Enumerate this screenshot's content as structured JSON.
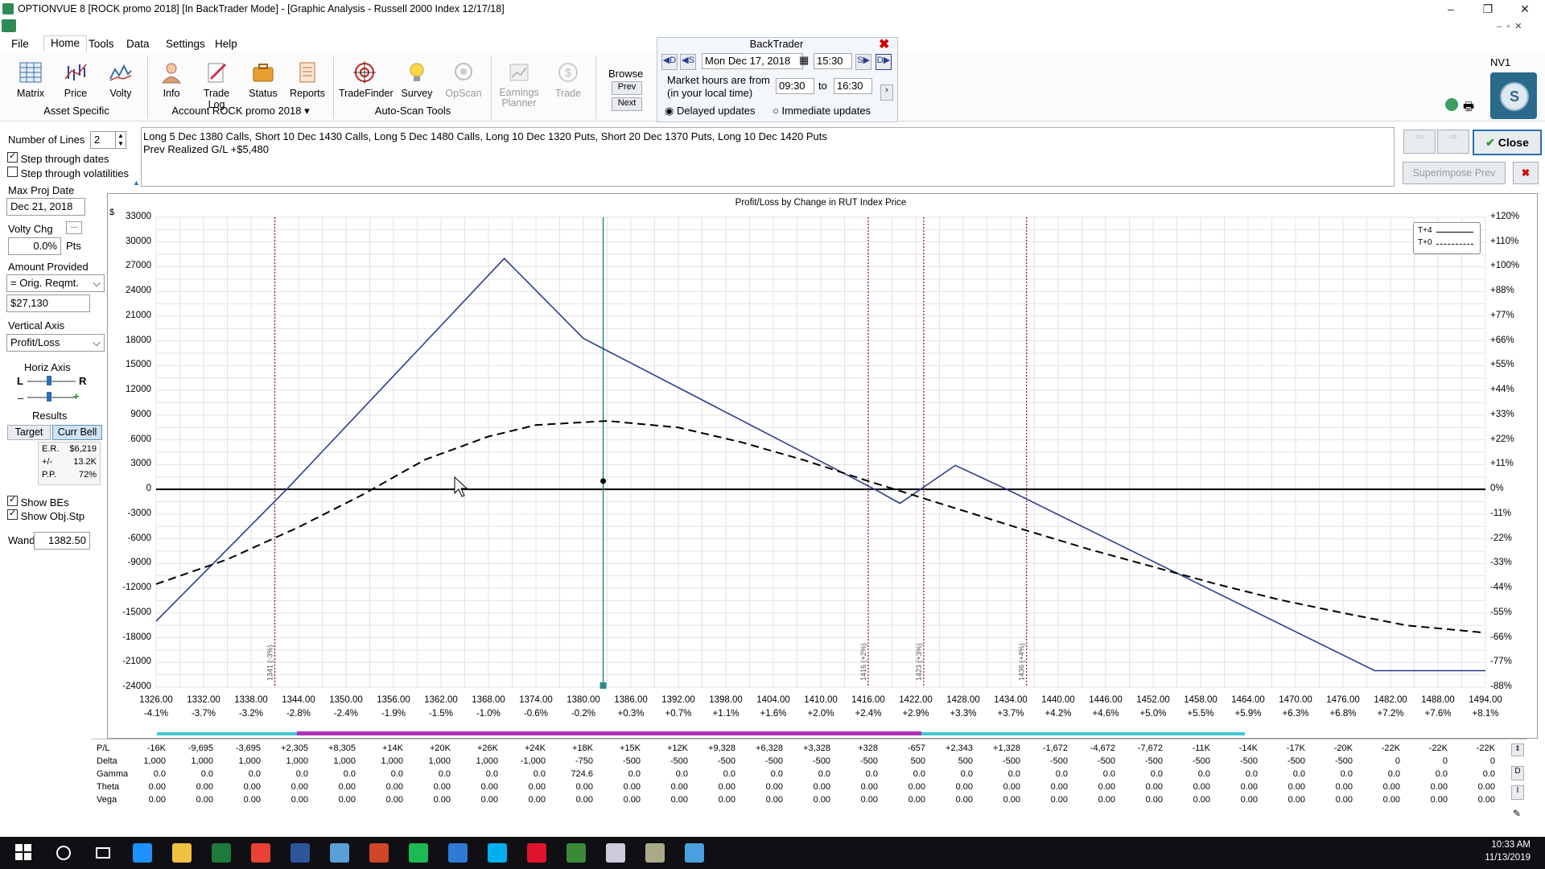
{
  "window": {
    "title": "OPTIONVUE 8   [ROCK promo 2018]   [In BackTrader Mode] - [Graphic Analysis - Russell 2000 Index  12/17/18]"
  },
  "menu": [
    "File",
    "Home",
    "Tools",
    "Data",
    "Settings",
    "Help"
  ],
  "ribbon": {
    "buttons": [
      {
        "label": "Matrix",
        "icon": "matrix-icon"
      },
      {
        "label": "Price",
        "icon": "price-chart-icon"
      },
      {
        "label": "Volty",
        "icon": "volatility-icon"
      },
      {
        "label": "Info",
        "icon": "person-info-icon"
      },
      {
        "label": "Trade Log",
        "icon": "trade-log-icon"
      },
      {
        "label": "Status",
        "icon": "briefcase-icon"
      },
      {
        "label": "Reports",
        "icon": "reports-icon"
      },
      {
        "label": "TradeFinder",
        "icon": "target-icon"
      },
      {
        "label": "Survey",
        "icon": "lightbulb-icon"
      },
      {
        "label": "OpScan",
        "icon": "opscan-icon"
      },
      {
        "label": "Earnings Planner",
        "icon": "earnings-icon"
      },
      {
        "label": "Trade",
        "icon": "dollar-icon"
      }
    ],
    "groups": {
      "asset": "Asset Specific",
      "account": "Account ROCK promo 2018",
      "autoscan": "Auto-Scan Tools"
    },
    "browse": {
      "label": "Browse",
      "prev": "Prev",
      "next": "Next"
    }
  },
  "backtrader": {
    "title": "BackTrader",
    "date": "Mon Dec 17, 2018",
    "time": "15:30",
    "market_label_1": "Market hours are from",
    "market_label_2": "(in your local time)",
    "from": "09:30",
    "to_label": "to",
    "to": "16:30",
    "delayed": "Delayed updates",
    "immediate": "Immediate updates",
    "nav": {
      "d_prev": "D",
      "s_prev": "S",
      "s_next": "S",
      "d_next": "D"
    }
  },
  "corner": {
    "label": "NV1",
    "logo": "S"
  },
  "left_panel": {
    "num_lines_label": "Number of Lines",
    "num_lines": "2",
    "step_dates": "Step through dates",
    "step_vols": "Step through volatilities",
    "max_proj_label": "Max Proj Date",
    "max_proj": "Dec 21, 2018",
    "volty_label": "Volty Chg",
    "volty_value": "0.0%",
    "volty_unit": "Pts",
    "amount_label": "Amount Provided",
    "amount_select": "= Orig. Reqmt.",
    "amount_value": "$27,130",
    "vaxis_label": "Vertical Axis",
    "vaxis_select": "Profit/Loss",
    "haxis_label": "Horiz Axis",
    "haxis_L": "L",
    "haxis_R": "R",
    "minus": "–",
    "plus": "+",
    "results_label": "Results",
    "target_btn": "Target",
    "currbell_btn": "Curr Bell",
    "stats": [
      {
        "k": "E.R.",
        "v": "$6,219"
      },
      {
        "k": "+/-",
        "v": "13.2K"
      },
      {
        "k": "P.P.",
        "v": "72%"
      }
    ],
    "show_bes": "Show BEs",
    "show_objstp": "Show Obj.Stp",
    "wand_label": "Wand",
    "wand_value": "1382.50"
  },
  "positions": {
    "line1": "Long 5 Dec 1380 Calls, Short 10 Dec 1430 Calls, Long 5 Dec 1480 Calls, Long 10 Dec 1320 Puts, Short 20 Dec 1370 Puts, Long 10 Dec 1420 Puts",
    "line2": "Prev Realized G/L +$5,480"
  },
  "right_buttons": {
    "close": "Close",
    "superimpose": "Superimpose Prev"
  },
  "chart_data": {
    "type": "line",
    "title": "Profit/Loss by Change in RUT Index Price",
    "y_unit": "$",
    "x_ticks": [
      "1326.00",
      "1332.00",
      "1338.00",
      "1344.00",
      "1350.00",
      "1356.00",
      "1362.00",
      "1368.00",
      "1374.00",
      "1380.00",
      "1386.00",
      "1392.00",
      "1398.00",
      "1404.00",
      "1410.00",
      "1416.00",
      "1422.00",
      "1428.00",
      "1434.00",
      "1440.00",
      "1446.00",
      "1452.00",
      "1458.00",
      "1464.00",
      "1470.00",
      "1476.00",
      "1482.00",
      "1488.00",
      "1494.00"
    ],
    "x_pct_ticks": [
      "-4.1%",
      "-3.7%",
      "-3.2%",
      "-2.8%",
      "-2.4%",
      "-1.9%",
      "-1.5%",
      "-1.0%",
      "-0.6%",
      "-0.2%",
      "+0.3%",
      "+0.7%",
      "+1.1%",
      "+1.6%",
      "+2.0%",
      "+2.4%",
      "+2.9%",
      "+3.3%",
      "+3.7%",
      "+4.2%",
      "+4.6%",
      "+5.0%",
      "+5.5%",
      "+5.9%",
      "+6.3%",
      "+6.8%",
      "+7.2%",
      "+7.6%",
      "+8.1%"
    ],
    "y_ticks": [
      "33000",
      "30000",
      "27000",
      "24000",
      "21000",
      "18000",
      "15000",
      "12000",
      "9000",
      "6000",
      "3000",
      "0",
      "-3000",
      "-6000",
      "-9000",
      "-12000",
      "-15000",
      "-18000",
      "-21000",
      "-24000"
    ],
    "y_pct_ticks": [
      "+120%",
      "+110%",
      "+100%",
      "+88%",
      "+77%",
      "+66%",
      "+55%",
      "+44%",
      "+33%",
      "+22%",
      "+11%",
      "0%",
      "-11%",
      "-22%",
      "-33%",
      "-44%",
      "-55%",
      "-66%",
      "-77%",
      "-88%"
    ],
    "xlim": [
      1326,
      1494
    ],
    "ylim": [
      -24000,
      33000
    ],
    "legend": [
      {
        "name": "T+4",
        "style": "solid"
      },
      {
        "name": "T+0",
        "style": "dashed"
      }
    ],
    "legend_position": "top-right",
    "series": [
      {
        "name": "T+4",
        "style": "solid",
        "points": [
          [
            1326,
            -16000
          ],
          [
            1342.5,
            0
          ],
          [
            1370,
            28000
          ],
          [
            1380,
            18300
          ],
          [
            1416.8,
            0
          ],
          [
            1420,
            -1700
          ],
          [
            1422.6,
            0
          ],
          [
            1427,
            2900
          ],
          [
            1433.5,
            0
          ],
          [
            1480,
            -22000
          ],
          [
            1494,
            -22000
          ]
        ]
      },
      {
        "name": "T+0",
        "style": "dashed",
        "points": [
          [
            1326,
            -11500
          ],
          [
            1335,
            -8500
          ],
          [
            1344,
            -4600
          ],
          [
            1352,
            -700
          ],
          [
            1360,
            3600
          ],
          [
            1368,
            6400
          ],
          [
            1374,
            7800
          ],
          [
            1383,
            8300
          ],
          [
            1392,
            7500
          ],
          [
            1400,
            5700
          ],
          [
            1408,
            3500
          ],
          [
            1416,
            1000
          ],
          [
            1422,
            -800
          ],
          [
            1428,
            -2600
          ],
          [
            1436,
            -5000
          ],
          [
            1444,
            -7300
          ],
          [
            1452,
            -9400
          ],
          [
            1460,
            -11500
          ],
          [
            1468,
            -13400
          ],
          [
            1476,
            -15000
          ],
          [
            1484,
            -16500
          ],
          [
            1494,
            -17400
          ]
        ]
      }
    ],
    "vlines": [
      {
        "x": 1341,
        "label": "1341 (-3%)",
        "style": "dotted-maroon"
      },
      {
        "x": 1382.5,
        "label": "",
        "style": "solid-teal"
      },
      {
        "x": 1416,
        "label": "1416 (+2%)",
        "style": "dotted-maroon"
      },
      {
        "x": 1423,
        "label": "1423 (+3%)",
        "style": "dotted-maroon"
      },
      {
        "x": 1436,
        "label": "1436 (+4%)",
        "style": "dotted-maroon"
      }
    ],
    "grid": true
  },
  "greeks_table": {
    "rows": [
      {
        "name": "P/L",
        "values": [
          "-16K",
          "-9,695",
          "-3,695",
          "+2,305",
          "+8,305",
          "+14K",
          "+20K",
          "+26K",
          "+24K",
          "+18K",
          "+15K",
          "+12K",
          "+9,328",
          "+6,328",
          "+3,328",
          "+328",
          "-657",
          "+2,343",
          "+1,328",
          "-1,672",
          "-4,672",
          "-7,672",
          "-11K",
          "-14K",
          "-17K",
          "-20K",
          "-22K",
          "-22K",
          "-22K"
        ]
      },
      {
        "name": "Delta",
        "values": [
          "1,000",
          "1,000",
          "1,000",
          "1,000",
          "1,000",
          "1,000",
          "1,000",
          "1,000",
          "-1,000",
          "-750",
          "-500",
          "-500",
          "-500",
          "-500",
          "-500",
          "-500",
          "500",
          "500",
          "-500",
          "-500",
          "-500",
          "-500",
          "-500",
          "-500",
          "-500",
          "-500",
          "0",
          "0",
          "0"
        ]
      },
      {
        "name": "Gamma",
        "values": [
          "0.0",
          "0.0",
          "0.0",
          "0.0",
          "0.0",
          "0.0",
          "0.0",
          "0.0",
          "0.0",
          "724.6",
          "0.0",
          "0.0",
          "0.0",
          "0.0",
          "0.0",
          "0.0",
          "0.0",
          "0.0",
          "0.0",
          "0.0",
          "0.0",
          "0.0",
          "0.0",
          "0.0",
          "0.0",
          "0.0",
          "0.0",
          "0.0",
          "0.0"
        ]
      },
      {
        "name": "Theta",
        "values": [
          "0.00",
          "0.00",
          "0.00",
          "0.00",
          "0.00",
          "0.00",
          "0.00",
          "0.00",
          "0.00",
          "0.00",
          "0.00",
          "0.00",
          "0.00",
          "0.00",
          "0.00",
          "0.00",
          "0.00",
          "0.00",
          "0.00",
          "0.00",
          "0.00",
          "0.00",
          "0.00",
          "0.00",
          "0.00",
          "0.00",
          "0.00",
          "0.00",
          "0.00"
        ]
      },
      {
        "name": "Vega",
        "values": [
          "0.00",
          "0.00",
          "0.00",
          "0.00",
          "0.00",
          "0.00",
          "0.00",
          "0.00",
          "0.00",
          "0.00",
          "0.00",
          "0.00",
          "0.00",
          "0.00",
          "0.00",
          "0.00",
          "0.00",
          "0.00",
          "0.00",
          "0.00",
          "0.00",
          "0.00",
          "0.00",
          "0.00",
          "0.00",
          "0.00",
          "0.00",
          "0.00",
          "0.00"
        ]
      }
    ],
    "side_buttons": [
      "D",
      "I"
    ]
  },
  "taskbar": {
    "time": "10:33 AM",
    "date": "11/13/2019",
    "apps": [
      "windows-start-icon",
      "cortana-icon",
      "task-view-icon",
      "edge-icon",
      "file-explorer-icon",
      "excel-icon",
      "chrome-icon",
      "word-icon",
      "notepad-icon",
      "powerpoint-icon",
      "spotify-icon",
      "todo-icon",
      "skype-icon",
      "opera-icon",
      "tradestation-icon",
      "optionvue-icon",
      "bug-icon",
      "snowflake-icon"
    ]
  },
  "colors": {
    "accent": "#2b3d8f",
    "teal": "#2a8a88",
    "maroon": "#8b1f4f",
    "cyanbar": "#40c8d0",
    "magentabar": "#b030b8"
  }
}
